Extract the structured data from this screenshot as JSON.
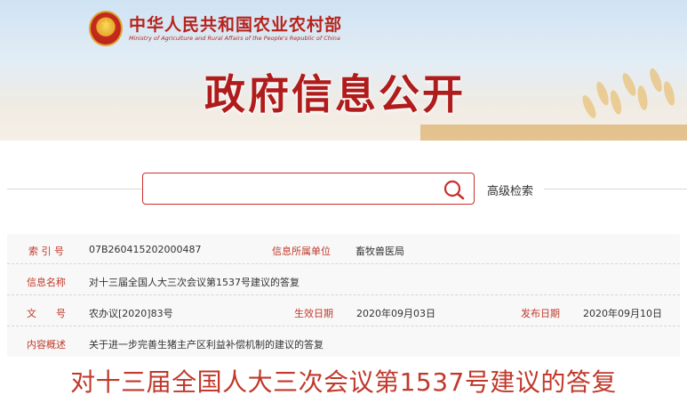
{
  "header": {
    "ministry_cn": "中华人民共和国农业农村部",
    "ministry_en": "Ministry of Agriculture and Rural Affairs of the People's Republic of China",
    "banner_title": "政府信息公开"
  },
  "search": {
    "value": "",
    "placeholder": "",
    "advanced_label": "高级检索"
  },
  "meta": {
    "index_label": "索 引 号",
    "index_value": "07B260415202000487",
    "dept_label": "信息所属单位",
    "dept_value": "畜牧兽医局",
    "name_label": "信息名称",
    "name_value": "对十三届全国人大三次会议第1537号建议的答复",
    "docno_label": "文　　号",
    "docno_value": "农办议[2020]83号",
    "effective_label": "生效日期",
    "effective_value": "2020年09月03日",
    "publish_label": "发布日期",
    "publish_value": "2020年09月10日",
    "summary_label": "内容概述",
    "summary_value": "关于进一步完善生猪主产区利益补偿机制的建议的答复"
  },
  "document": {
    "title": "对十三届全国人大三次会议第1537号建议的答复"
  },
  "colors": {
    "accent_red": "#c0392b",
    "brand_red": "#b8231b"
  }
}
